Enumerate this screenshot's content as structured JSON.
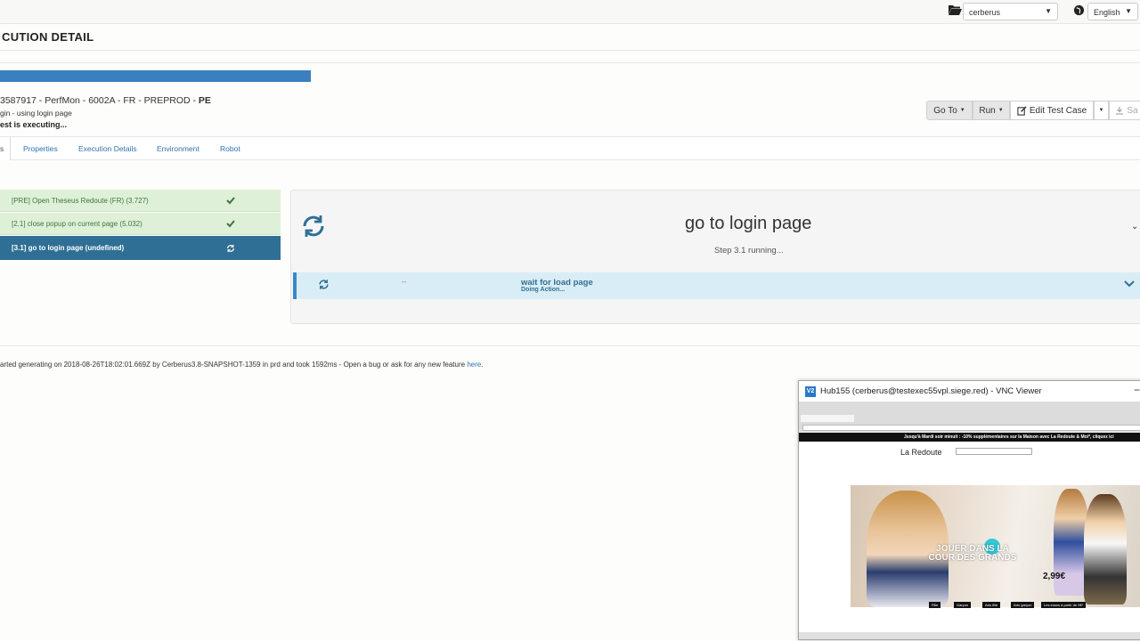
{
  "topbar": {
    "environment": "cerberus",
    "language": "English"
  },
  "page": {
    "title": "CUTION DETAIL"
  },
  "progress": {
    "fraction": 0.27
  },
  "testcase": {
    "title_prefix": "3587917 - PerfMon - 6002A - FR - PREPROD - ",
    "title_bold": "PE",
    "description": "gin - using login page",
    "status": "est is executing..."
  },
  "actions": {
    "goto": "Go To",
    "run": "Run",
    "edit": "Edit Test Case",
    "save": "Sa"
  },
  "tabs": [
    "s",
    "Properties",
    "Execution Details",
    "Environment",
    "Robot"
  ],
  "steps": [
    {
      "label": "[PRE] Open Theseus Redoute (FR) (3.727)",
      "state": "ok"
    },
    {
      "label": "[2.1] close popup on current page (5.032)",
      "state": "ok"
    },
    {
      "label": "[3.1] go to login page (undefined)",
      "state": "running"
    }
  ],
  "detail": {
    "title": "go to login page",
    "status": "Step 3.1 running...",
    "action": {
      "dash": "--",
      "name": "wait for load page",
      "sub": "Doing Action..."
    }
  },
  "footer": {
    "text": "arted generating on 2018-08-26T18:02:01.669Z by Cerberus3.8-SNAPSHOT-1359 in prd and took 1592ms - Open a bug or ask for any new feature ",
    "link": "here",
    "end": "."
  },
  "vnc": {
    "title": "Hub155 (cerberus@testexec55vpl.siege.red) - VNC Viewer",
    "logo": "V2",
    "promo": "Jusqu'à Mardi soir minuit : -10% supplémentaires sur la Maison avec La Redoute & Moi*, cliquez ici",
    "site_logo": "La Redoute",
    "hero_text": "JOUER DANS LA COUR DES GRANDS",
    "price": "2,99€",
    "hero_buttons": [
      "Fille",
      "Garçon",
      "Ado fille",
      "Ado garçon",
      "Les essos à partir de 9€*"
    ]
  },
  "colors": {
    "progress": "#3a7fbf",
    "step_ok_bg": "#dff0d8",
    "step_active_bg": "#2f6f95",
    "link": "#2f72b3",
    "action_row_bg": "#d9edf7"
  }
}
